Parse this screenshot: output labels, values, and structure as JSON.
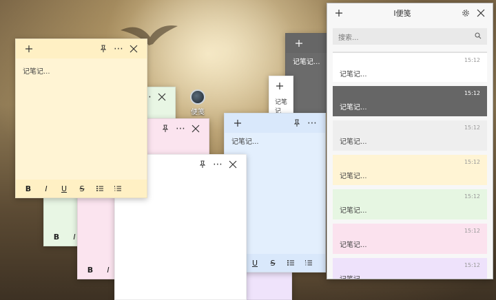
{
  "desktop": {
    "icon_label": "便笺"
  },
  "hub": {
    "title": "I便笺",
    "search_placeholder": "搜索...",
    "notes": [
      {
        "time": "15:12",
        "text": "记笔记...",
        "color": "white"
      },
      {
        "time": "15:12",
        "text": "记笔记...",
        "color": "gray"
      },
      {
        "time": "15:12",
        "text": "记笔记...",
        "color": "light"
      },
      {
        "time": "15:12",
        "text": "记笔记...",
        "color": "yellow"
      },
      {
        "time": "15:12",
        "text": "记笔记...",
        "color": "green"
      },
      {
        "time": "15:12",
        "text": "记笔记...",
        "color": "pink"
      },
      {
        "time": "15:12",
        "text": "记笔记...",
        "color": "purple"
      }
    ]
  },
  "notes": {
    "yellow": {
      "text": "记笔记..."
    },
    "blue": {
      "text": "记笔记..."
    },
    "gray": {
      "text": "记笔记..."
    },
    "white_small": {
      "text": "记笔记"
    }
  },
  "format": {
    "bold": "B",
    "italic": "I",
    "underline": "U",
    "strike": "S"
  },
  "icons": {
    "add": "add-icon",
    "pin": "pin-icon",
    "more": "more-icon",
    "close": "close-icon",
    "settings": "gear-icon",
    "search": "search-icon",
    "bullets": "bullet-list-icon",
    "numbered": "numbered-list-icon"
  },
  "colors": {
    "yellow": "#fff4d4",
    "green": "#e8f6e4",
    "pink": "#fbe4ef",
    "blue": "#e3effd",
    "gray": "#6b6b6b",
    "purple": "#efe3fb"
  }
}
